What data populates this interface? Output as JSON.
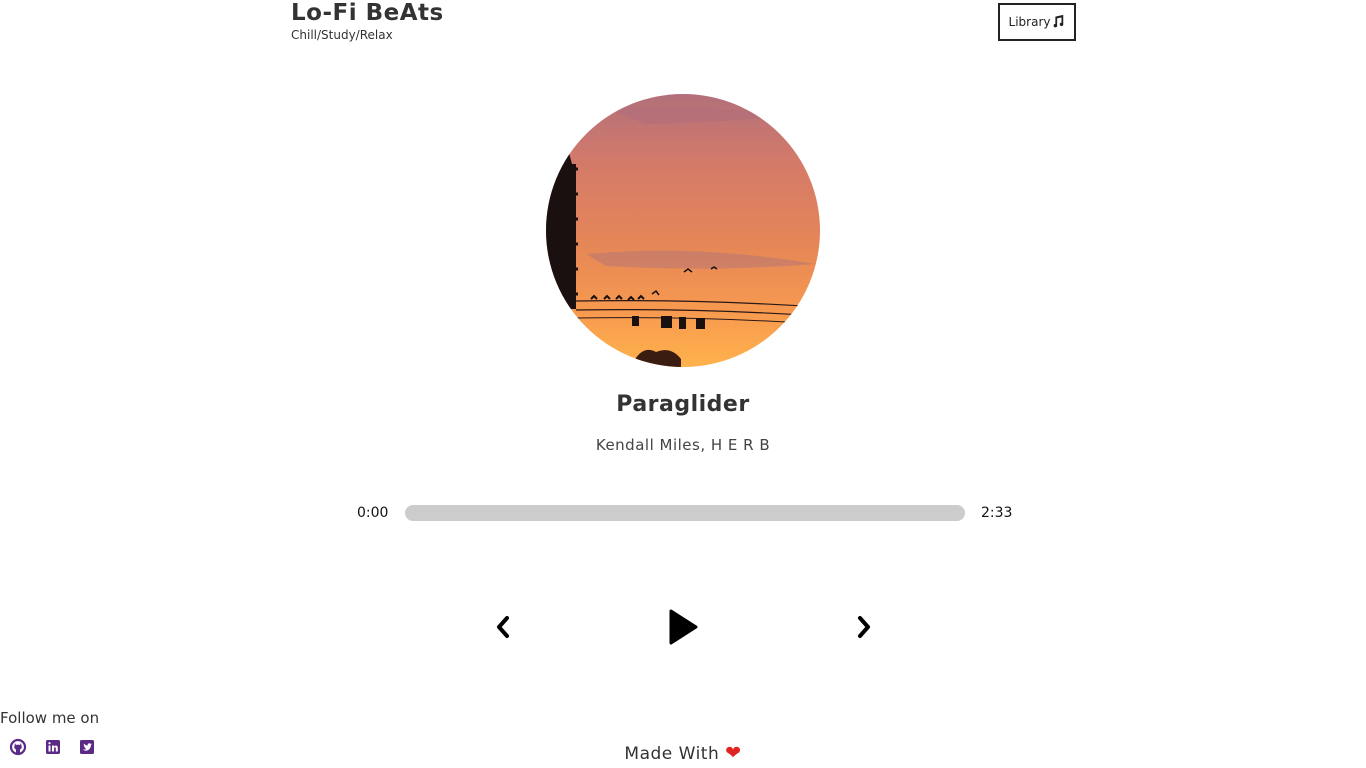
{
  "header": {
    "title": "Lo-Fi BeAts",
    "subtitle": "Chill/Study/Relax",
    "library_label": "Library"
  },
  "player": {
    "song_title": "Paraglider",
    "artist": "Kendall Miles, H E R B",
    "current_time": "0:00",
    "total_time": "2:33",
    "progress_fraction": 0
  },
  "footer": {
    "follow_label": "Follow me on",
    "made_with": "Made With",
    "heart": "❤"
  },
  "icons": {
    "library": "music-note-icon",
    "prev": "chevron-left-icon",
    "play": "play-icon",
    "next": "chevron-right-icon",
    "social": [
      "github-icon",
      "linkedin-icon",
      "twitter-icon"
    ]
  },
  "colors": {
    "text": "#333333",
    "track": "#cccccc",
    "social_icon": "#5b2a86",
    "heart": "#e02424"
  }
}
